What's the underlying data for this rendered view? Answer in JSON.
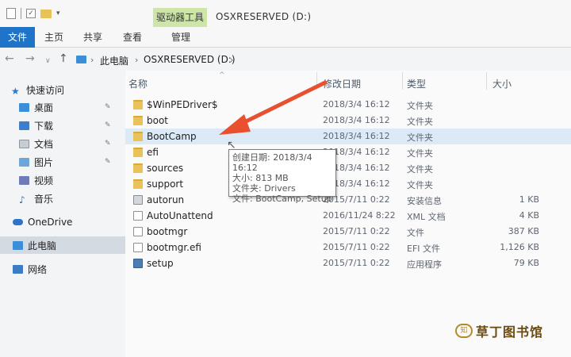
{
  "window": {
    "context_tab": "驱动器工具",
    "title": "OSXRESERVED (D:)"
  },
  "ribbon": {
    "file": "文件",
    "home": "主页",
    "share": "共享",
    "view": "查看",
    "manage": "管理"
  },
  "address": {
    "crumbs": [
      "此电脑",
      "OSXRESERVED (D:)"
    ]
  },
  "nav": {
    "quick_access": "快速访问",
    "desktop": "桌面",
    "downloads": "下载",
    "documents": "文档",
    "pictures": "图片",
    "videos": "视频",
    "music": "音乐",
    "onedrive": "OneDrive",
    "this_pc": "此电脑",
    "network": "网络"
  },
  "columns": {
    "name": "名称",
    "modified": "修改日期",
    "type": "类型",
    "size": "大小"
  },
  "files": [
    {
      "name": "$WinPEDriver$",
      "date": "2018/3/4 16:12",
      "type": "文件夹",
      "size": ""
    },
    {
      "name": "boot",
      "date": "2018/3/4 16:12",
      "type": "文件夹",
      "size": ""
    },
    {
      "name": "BootCamp",
      "date": "2018/3/4 16:12",
      "type": "文件夹",
      "size": ""
    },
    {
      "name": "efi",
      "date": "2018/3/4 16:12",
      "type": "文件夹",
      "size": ""
    },
    {
      "name": "sources",
      "date": "2018/3/4 16:12",
      "type": "文件夹",
      "size": ""
    },
    {
      "name": "support",
      "date": "2018/3/4 16:12",
      "type": "文件夹",
      "size": ""
    },
    {
      "name": "autorun",
      "date": "2015/7/11 0:22",
      "type": "安装信息",
      "size": "1 KB"
    },
    {
      "name": "AutoUnattend",
      "date": "2016/11/24 8:22",
      "type": "XML 文档",
      "size": "4 KB"
    },
    {
      "name": "bootmgr",
      "date": "2015/7/11 0:22",
      "type": "文件",
      "size": "387 KB"
    },
    {
      "name": "bootmgr.efi",
      "date": "2015/7/11 0:22",
      "type": "EFI 文件",
      "size": "1,126 KB"
    },
    {
      "name": "setup",
      "date": "2015/7/11 0:22",
      "type": "应用程序",
      "size": "79 KB"
    }
  ],
  "tooltip": {
    "created": "创建日期: 2018/3/4 16:12",
    "size": "大小: 813 MB",
    "folders": "文件夹: Drivers",
    "files": "文件: BootCamp, Setup"
  },
  "watermark": {
    "badge": "知",
    "text": "草丁图书馆"
  },
  "colors": {
    "file_tab": "#1f74c8",
    "context_tab": "#cde6a8",
    "annotation_arrow": "#e8502f",
    "hover_row": "#dceaf7"
  }
}
